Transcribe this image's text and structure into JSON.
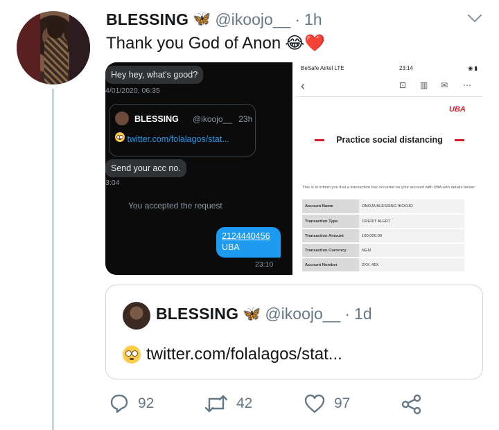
{
  "tweet": {
    "display_name": "BLESSING",
    "handle": "@ikoojo__",
    "separator": "·",
    "time": "1h",
    "text": "Thank you God of Anon",
    "text_emojis": "😂❤️",
    "name_emoji": "🦋"
  },
  "media_left": {
    "received_msg_1": "Hey hey, what's good?",
    "timestamp_1": "4/01/2020, 06:35",
    "embed_name": "BLESSING",
    "embed_handle": "@ikoojo__",
    "embed_time": "23h",
    "embed_link": "twitter.com/folalagos/stat...",
    "received_msg_2": "Send your acc no.",
    "timestamp_2": "3:04",
    "accepted_text": "You accepted the request",
    "sent_account": "2124440456",
    "sent_bank": "UBA",
    "sent_time": "23:10"
  },
  "media_right": {
    "carrier": "BeSafe Airtel  LTE",
    "clock": "23:14",
    "logo": "UBA",
    "banner": "Practice social distancing",
    "notice": "This is to inform you that a transaction has occurred on your account with UBA with details below:",
    "rows": [
      {
        "k": "Account Name",
        "v": "ONOJA BLESSING IKOOJO"
      },
      {
        "k": "Transaction Type",
        "v": "CREDIT ALERT"
      },
      {
        "k": "Transaction Amount",
        "v": "100,000.00"
      },
      {
        "k": "Transaction Currency",
        "v": "NGN"
      },
      {
        "k": "Account Number",
        "v": "2XX..45X"
      }
    ]
  },
  "quoted": {
    "display_name": "BLESSING",
    "handle": "@ikoojo__",
    "separator": "·",
    "time": "1d",
    "text": "twitter.com/folalagos/stat..."
  },
  "actions": {
    "replies": "92",
    "retweets": "42",
    "likes": "97"
  },
  "icons": {
    "reply": "reply-icon",
    "retweet": "retweet-icon",
    "like": "heart-icon",
    "share": "share-icon",
    "menu": "chevron-down-icon"
  },
  "colors": {
    "secondary_text": "#657786",
    "link_blue": "#1d9bf0",
    "uba_red": "#d71e28"
  }
}
